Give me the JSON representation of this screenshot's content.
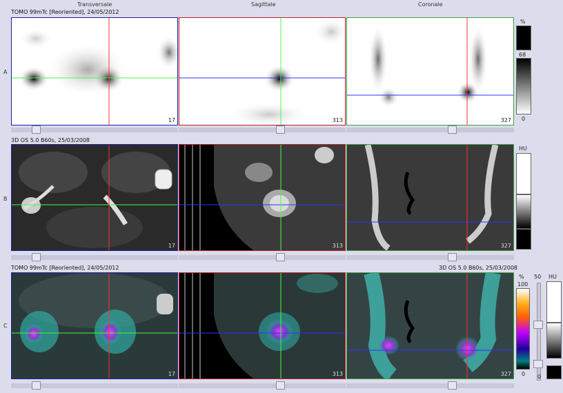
{
  "columns": [
    "Transversale",
    "Sagittale",
    "Coronale"
  ],
  "rows": [
    {
      "label": "A",
      "info": "TOMO 99mTc [Reoriented], 24/05/2012",
      "info_right": ""
    },
    {
      "label": "B",
      "info": "3D  OS  5.0  B60s, 25/03/2008",
      "info_right": ""
    },
    {
      "label": "C",
      "info": "TOMO 99mTc [Reoriented], 24/05/2012",
      "info_right": "3D  OS  5.0  B60s, 25/03/2008"
    }
  ],
  "slices": [
    "17",
    "313",
    "327"
  ],
  "scales": {
    "a": {
      "unit": "%",
      "top": "68",
      "bottom": "0"
    },
    "b": {
      "unit": "HU"
    },
    "c": {
      "unit": "%",
      "top": "100",
      "bottom": "0",
      "mid": "50",
      "unit2": "HU",
      "bottom2": "0"
    }
  },
  "colors": {
    "frame_transversale": "#2020a0",
    "frame_sagittale": "#c02020",
    "frame_coronale": "#40a040",
    "crosshair_green": "#40ff40",
    "crosshair_blue": "#3030ff",
    "crosshair_red": "#ff3030"
  }
}
